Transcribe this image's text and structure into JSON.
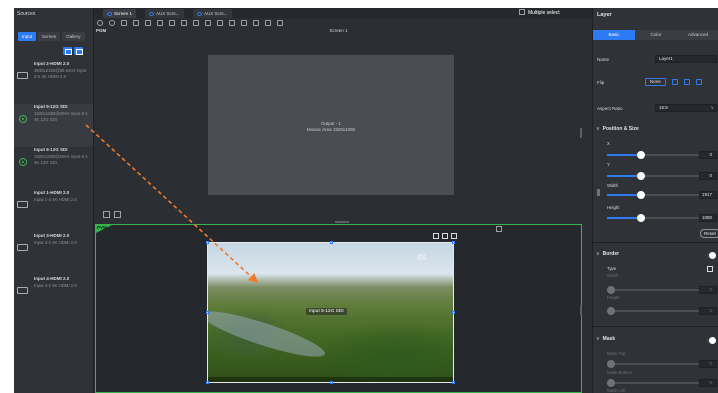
{
  "sources": {
    "title": "Sources",
    "tabs": [
      {
        "label": "Input",
        "active": true
      },
      {
        "label": "Screen",
        "active": false
      },
      {
        "label": "Gallery",
        "active": false
      }
    ],
    "inputs": [
      {
        "name": "Input 2-HDMI 2.0",
        "details": "3840x2160@59.94Hz Input 2-2 4K HDMI 2.0",
        "icon": "hdmi-icon"
      },
      {
        "name": "Input 5-12G SDI",
        "details": "1920x1080@60Hz Input 5-1 4K 12G SDI",
        "icon": "sdi-icon"
      },
      {
        "name": "Input 6-12G SDI",
        "details": "1920x1080@60Hz Input 6-1 4K 12G SDI",
        "icon": "sdi-icon"
      },
      {
        "name": "Input 1-HDMI 2.0",
        "details": "Input 1-2 4K HDMI 2.0",
        "icon": "hdmi-icon"
      },
      {
        "name": "Input 3-HDMI 2.0",
        "details": "Input 3-2 4K HDMI 2.0",
        "icon": "hdmi-icon"
      },
      {
        "name": "Input 4-HDMI 2.0",
        "details": "Input 4-2 4K HDMI 2.0",
        "icon": "hdmi-icon"
      }
    ]
  },
  "tabs": [
    {
      "label": "Screen 1",
      "active": true
    },
    {
      "label": "AUX Scre...",
      "active": false
    },
    {
      "label": "AUX Scre...",
      "active": false
    }
  ],
  "multiple_select": "Multiple select",
  "pgm": {
    "tag": "PGM",
    "screen_name": "Screen 1",
    "output_line1": "Output - 1",
    "output_line2": "Mosaic Area 1920x1080"
  },
  "pvw": {
    "tag": "PVW",
    "layer_label": "Input 5-12G SDI",
    "watermark": "4K"
  },
  "layer_panel": {
    "title": "Layer",
    "tabs": [
      {
        "label": "Basic",
        "active": true
      },
      {
        "label": "Color",
        "active": false
      },
      {
        "label": "Advanced",
        "active": false
      }
    ],
    "name_label": "Name",
    "name_value": "Layer1",
    "flip_label": "Flip",
    "flip_none": "None",
    "aspect_label": "Aspect Ratio",
    "aspect_value": "16:9",
    "position_size": {
      "title": "Position & Size",
      "x_label": "X",
      "x_value": "0",
      "y_label": "Y",
      "y_value": "0",
      "width_label": "Width",
      "width_value": "1917",
      "height_label": "Height",
      "height_value": "1080",
      "reset": "Reset"
    },
    "border": {
      "title": "Border",
      "type_label": "Type",
      "width_label": "Width",
      "width_value": "2",
      "height_label": "Height",
      "height_value": "2"
    },
    "mask": {
      "title": "Mask",
      "top_label": "Mask Top",
      "top_value": "0",
      "bottom_label": "Mask Bottom",
      "bottom_value": "0",
      "left_label": "Mask Left"
    }
  },
  "colors": {
    "accent": "#2d7bf4",
    "pvw_green": "#37b24d",
    "drag_arrow": "#f07a2a",
    "panel_bg": "#2f3237"
  }
}
